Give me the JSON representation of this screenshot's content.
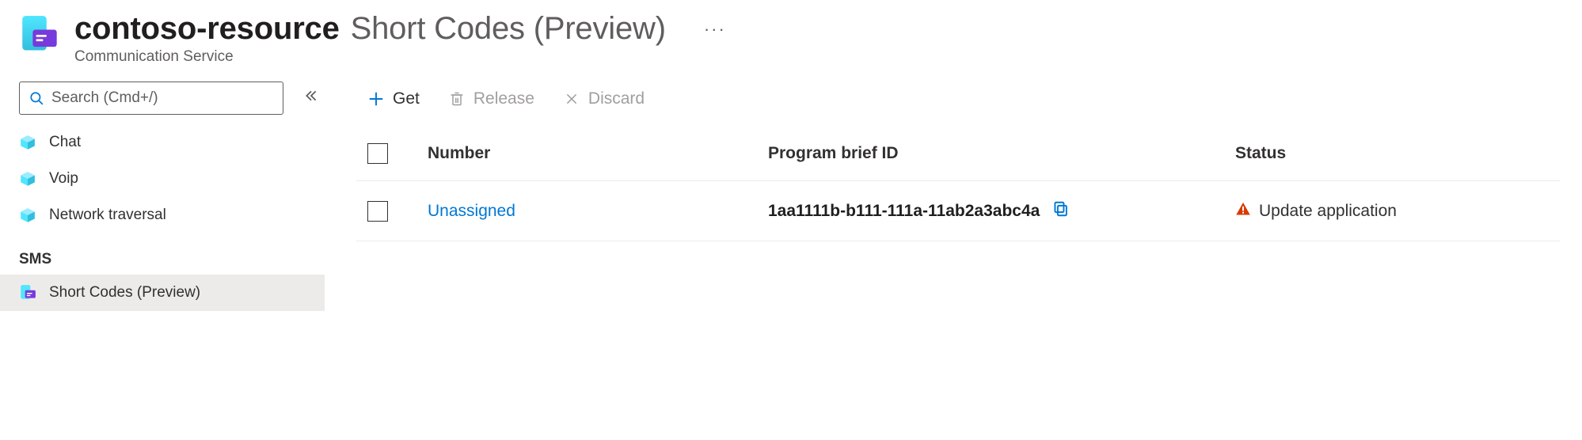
{
  "header": {
    "resource_name": "contoso-resource",
    "feature_title": "Short Codes (Preview)",
    "resource_type": "Communication Service"
  },
  "sidebar": {
    "search_placeholder": "Search (Cmd+/)",
    "items": [
      {
        "label": "Chat",
        "icon": "cube"
      },
      {
        "label": "Voip",
        "icon": "cube"
      },
      {
        "label": "Network traversal",
        "icon": "cube"
      }
    ],
    "section_label": "SMS",
    "sms_items": [
      {
        "label": "Short Codes (Preview)",
        "icon": "short-codes",
        "selected": true
      }
    ]
  },
  "commandbar": {
    "get": "Get",
    "release": "Release",
    "discard": "Discard"
  },
  "table": {
    "headers": {
      "number": "Number",
      "brief": "Program brief ID",
      "status": "Status"
    },
    "rows": [
      {
        "number": "Unassigned",
        "brief_id": "1aa1111b-b111-111a-11ab2a3abc4a",
        "status": "Update application"
      }
    ]
  }
}
